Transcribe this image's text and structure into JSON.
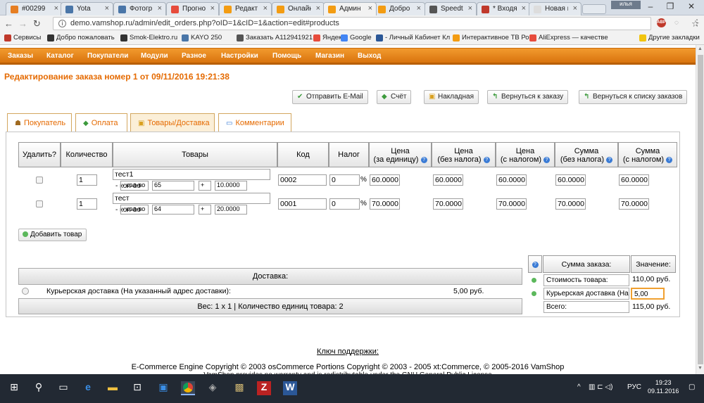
{
  "browser": {
    "tabs": [
      {
        "title": "#00299",
        "color": "#e67e22"
      },
      {
        "title": "Yota",
        "color": "#4a76a8"
      },
      {
        "title": "Фотогр",
        "color": "#4a76a8"
      },
      {
        "title": "Прогно",
        "color": "#e74c3c"
      },
      {
        "title": "Редакт",
        "color": "#f39c12"
      },
      {
        "title": "Онлайн",
        "color": "#f39c12"
      },
      {
        "title": "Админ",
        "color": "#f39c12"
      },
      {
        "title": "Добро",
        "color": "#f39c12"
      },
      {
        "title": "Speedt",
        "color": "#555555"
      },
      {
        "title": "* Входя",
        "color": "#c0392b"
      },
      {
        "title": "Новая вкла",
        "color": "#dddddd"
      }
    ],
    "window_user": "илья",
    "url": "demo.vamshop.ru/admin/edit_orders.php?oID=1&cID=1&action=edit#products",
    "bookmarks": [
      {
        "label": "Сервисы",
        "color": "#c0392b"
      },
      {
        "label": "Добро пожаловать",
        "color": "#333333"
      },
      {
        "label": "Smok-Elektro.ru",
        "color": "#333333"
      },
      {
        "label": "KAYO 250",
        "color": "#4a76a8"
      },
      {
        "label": "Заказать A112941921",
        "color": "#555555"
      },
      {
        "label": "Яндекс",
        "color": "#e74c3c"
      },
      {
        "label": "Google",
        "color": "#4285f4"
      },
      {
        "label": "- Личный Кабинет Кл",
        "color": "#2b5797"
      },
      {
        "label": "Интерактивное ТВ Ро",
        "color": "#f39c12"
      },
      {
        "label": "AliExpress — качестве",
        "color": "#e74c3c"
      },
      {
        "label": "Другие закладки",
        "color": "#f1c40f"
      }
    ]
  },
  "admin_nav": [
    "Заказы",
    "Каталог",
    "Покупатели",
    "Модули",
    "Разное",
    "Настройки",
    "Помощь",
    "Магазин",
    "Выход"
  ],
  "page_title": "Редактирование заказа номер 1 от 09/11/2016 19:21:38",
  "actions": [
    "Отправить E-Mail",
    "Счёт",
    "Накладная",
    "Вернуться к заказу",
    "Вернуться к списку заказов"
  ],
  "form_tabs": [
    "Покупатель",
    "Оплата",
    "Товары/Доставка",
    "Комментарии"
  ],
  "table": {
    "headers": [
      "Удалить?",
      "Количество",
      "Товары",
      "Код",
      "Налог",
      "Цена\n(за единицу)",
      "Цена\n(без налога)",
      "Цена\n(с налогом)",
      "Сумма\n(без налога)",
      "Сумма\n(с налогом)"
    ],
    "percent": "%",
    "rows": [
      {
        "qty": "1",
        "name": "тест1",
        "attr_prefix": "- кол-во",
        "attr_value": "65",
        "attr_sign": "+",
        "attr_price": "10.0000",
        "code": "0002",
        "tax": "0",
        "price_unit": "60.0000",
        "price_net": "60.0000",
        "price_gross": "60.0000",
        "sum_net": "60.0000",
        "sum_gross": "60.0000"
      },
      {
        "qty": "1",
        "name": "тест",
        "attr_prefix": "- кол-во",
        "attr_value": "64",
        "attr_sign": "+",
        "attr_price": "20.0000",
        "code": "0001",
        "tax": "0",
        "price_unit": "70.0000",
        "price_net": "70.0000",
        "price_gross": "70.0000",
        "sum_net": "70.0000",
        "sum_gross": "70.0000"
      }
    ]
  },
  "add_product": "Добавить товар",
  "shipping": {
    "header": "Доставка:",
    "option_label": "Курьерская доставка (На указанный адрес доставки):",
    "option_price": "5,00 руб.",
    "footer": "Вес: 1 х 1 | Количество единиц товара: 2"
  },
  "totals": {
    "col1": "Сумма заказа:",
    "col2": "Значение:",
    "rows": [
      {
        "label": "Стоимость товара:",
        "value": "110,00 руб."
      },
      {
        "label": "Курьерская доставка (На",
        "value": "5,00"
      },
      {
        "label": "Всего:",
        "value": "115,00 руб."
      }
    ]
  },
  "footer": {
    "support_key": "Ключ поддержки:",
    "copyright": "E-Commerce Engine Copyright © 2003 osCommerce Portions Copyright © 2003 - 2005 xt:Commerce, © 2005-2016 VamShop",
    "license_partial": "VamShop provides no warranty and is redistributable under the GNU General Public License"
  },
  "taskbar": {
    "lang": "РУС",
    "time": "19:23",
    "date": "09.11.2016"
  }
}
